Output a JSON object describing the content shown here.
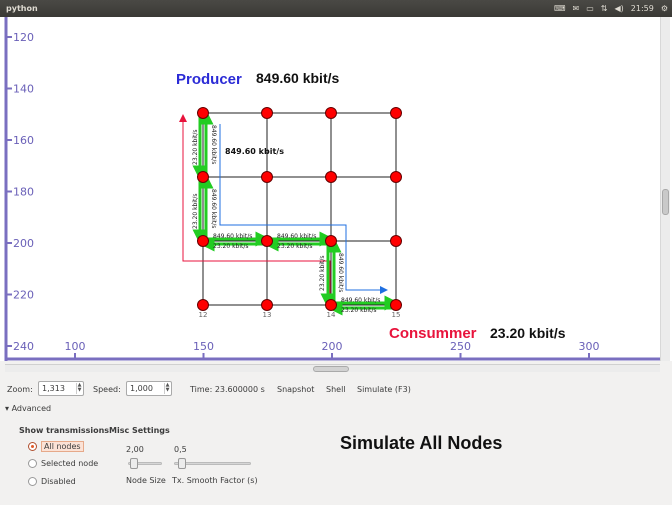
{
  "titlebar": {
    "title": "python",
    "time": "21:59",
    "tray_icons": [
      "keyboard-icon",
      "mail-icon",
      "battery-icon",
      "network-icon",
      "volume-icon",
      "gear-icon"
    ]
  },
  "canvas": {
    "y_ticks": [
      "120",
      "140",
      "160",
      "180",
      "200",
      "220",
      "240"
    ],
    "x_ticks": [
      "100",
      "150",
      "200",
      "250",
      "300"
    ],
    "producer_label": "Producer",
    "producer_rate": "849.60 kbit/s",
    "consumer_label": "Consummer",
    "consumer_rate": "23.20 kbit/s",
    "mid_rate": "849.60 kbit/s",
    "node_labels": [
      "12",
      "13",
      "14",
      "15"
    ],
    "edge_labels": {
      "a1": "849.60 kbit/s",
      "a2": "23.20 kbit/s",
      "b1": "849.60 kbit/s",
      "b2": "23.20 kbit/s",
      "c1": "849.60 kbit/s",
      "c2": "23.20 kbit/s",
      "v1": "23.20 kbit/s",
      "v2": "849.60 kbit/s",
      "v3": "23.20 kbit/s",
      "v4": "849.60 kbit/s",
      "v5": "849.60 kbit/s",
      "v6": "23.20 kbit/s"
    },
    "colors": {
      "producer": "#2b2bd6",
      "consumer": "#e8133c",
      "node": "#ff0000",
      "flow": "#22cc22",
      "path_red": "#e8133c",
      "path_blue": "#1f6fe0"
    }
  },
  "toolbar": {
    "zoom_label": "Zoom:",
    "zoom_value": "1,313",
    "speed_label": "Speed:",
    "speed_value": "1,000",
    "time_text": "Time: 23.600000 s",
    "snapshot": "Snapshot",
    "shell": "Shell",
    "simulate": "Simulate (F3)"
  },
  "advanced": {
    "expander": "Advanced",
    "show_transmissions": "Show transmissions",
    "options": [
      "All nodes",
      "Selected node",
      "Disabled"
    ],
    "selected_option": "All nodes",
    "misc_settings": "Misc Settings",
    "node_size_value": "2,00",
    "node_size_label": "Node Size",
    "smooth_value": "0,5",
    "smooth_label": "Tx. Smooth Factor (s)",
    "node_size_level": 0.05,
    "smooth_level": 0.05
  },
  "caption": "Simulate All Nodes"
}
